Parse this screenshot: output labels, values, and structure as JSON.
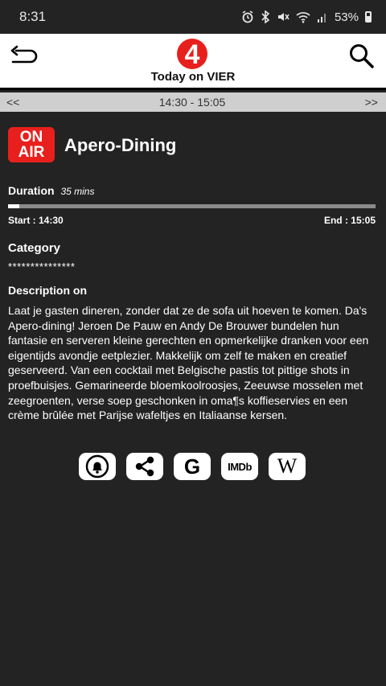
{
  "status_bar": {
    "time": "8:31",
    "battery": "53%"
  },
  "header": {
    "title": "Today on VIER",
    "logo_text": "4",
    "icons": [
      "back-arrow-icon",
      "search-icon"
    ],
    "brand_color": "#e8201d"
  },
  "time_nav": {
    "prev": "<<",
    "range": "14:30 - 15:05",
    "next": ">>"
  },
  "program": {
    "badge_line1": "ON",
    "badge_line2": "AIR",
    "title": "Apero-Dining",
    "duration_label": "Duration",
    "duration_value": "35 mins",
    "progress_fraction": 0.03,
    "start": "Start : 14:30",
    "end": "End : 15:05",
    "category_label": "Category",
    "category_value": "***************",
    "description_label": "Description on",
    "description": "Laat je gasten dineren, zonder dat ze de sofa uit hoeven te komen. Da's Apero-dining! Jeroen De Pauw en Andy De Brouwer bundelen hun fantasie en serveren kleine gerechten en opmerkelijke dranken voor een eigentijds avondje eetplezier. Makkelijk om zelf te maken en creatief geserveerd. Van een cocktail met Belgische pastis tot pittige shots in proefbuisjes. Gemarineerde bloemkoolroosjes, Zeeuwse mosselen met zeegroenten, verse soep geschonken in oma¶s koffieservies en een crème brûlée met Parijse wafeltjes en Italiaanse kersen."
  },
  "actions": {
    "icons": [
      "alarm-bell-icon",
      "share-icon",
      "google-icon",
      "imdb-icon",
      "wikipedia-icon"
    ],
    "google_label": "G",
    "imdb_label": "IMDb",
    "wiki_label": "W"
  }
}
